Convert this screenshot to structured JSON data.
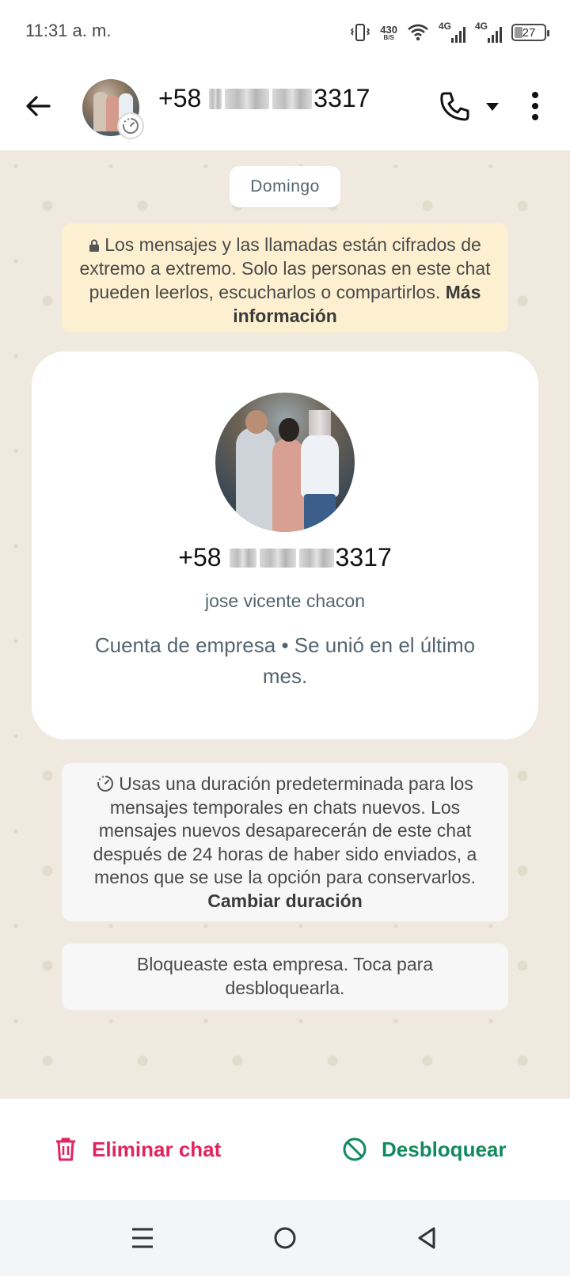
{
  "status_bar": {
    "time": "11:31 a. m.",
    "speed_value": "430",
    "speed_unit": "B/S",
    "net1": "4G",
    "net2": "4G",
    "battery": "27"
  },
  "header": {
    "phone_prefix": "+58",
    "phone_suffix": "3317"
  },
  "chat": {
    "date_chip": "Domingo",
    "encryption_text": "Los mensajes y las llamadas están cifrados de extremo a extremo. Solo las personas en este chat pueden leerlos, escucharlos o compartirlos.",
    "encryption_link": "Más información",
    "profile": {
      "phone_prefix": "+58",
      "phone_suffix": "3317",
      "name": "jose vicente chacon",
      "info": "Cuenta de empresa • Se unió en el último mes."
    },
    "timer_text": "Usas una duración predeterminada para los mensajes temporales en chats nuevos. Los mensajes nuevos desaparecerán de este chat después de 24 horas de haber sido enviados, a menos que se use la opción para conservarlos.",
    "timer_link": "Cambiar duración",
    "blocked_text": "Bloqueaste esta empresa. Toca para desbloquearla."
  },
  "actions": {
    "delete_label": "Eliminar chat",
    "unblock_label": "Desbloquear"
  },
  "colors": {
    "delete": "#e0245e",
    "unblock": "#138a5e",
    "encryption_bg": "#fdf0d0",
    "chat_bg": "#efe9df"
  },
  "icons": {
    "back": "arrow-left-icon",
    "call": "phone-icon",
    "menu": "more-vert-icon",
    "delete": "trash-icon",
    "unblock": "block-icon"
  }
}
